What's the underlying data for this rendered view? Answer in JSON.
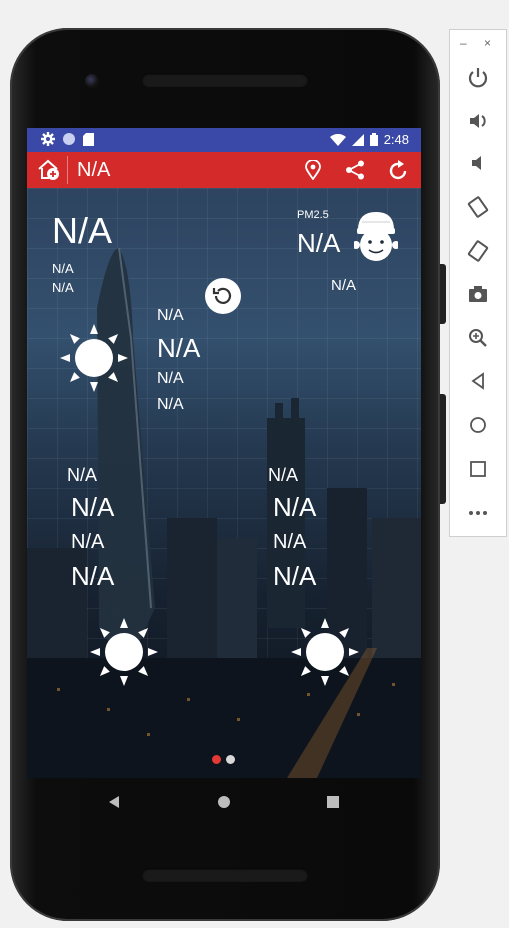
{
  "status_bar": {
    "time": "2:48"
  },
  "app_bar": {
    "city": "N/A"
  },
  "current": {
    "temp": "N/A",
    "line1": "N/A",
    "line2": "N/A",
    "pm_label": "PM2.5",
    "pm_value": "N/A",
    "air_quality": "N/A"
  },
  "today": {
    "small1": "N/A",
    "large": "N/A",
    "small2": "N/A",
    "small3": "N/A"
  },
  "forecast": [
    {
      "line1": "N/A",
      "line2": "N/A",
      "line3": "N/A",
      "line4": "N/A"
    },
    {
      "line1": "N/A",
      "line2": "N/A",
      "line3": "N/A",
      "line4": "N/A"
    }
  ],
  "pager": {
    "count": 2,
    "active": 1
  },
  "emulator_panel": {
    "window_controls": [
      "–",
      "×"
    ]
  },
  "colors": {
    "status_bar": "#3a49a8",
    "app_bar": "#d42a2a",
    "active_dot": "#e53935"
  }
}
